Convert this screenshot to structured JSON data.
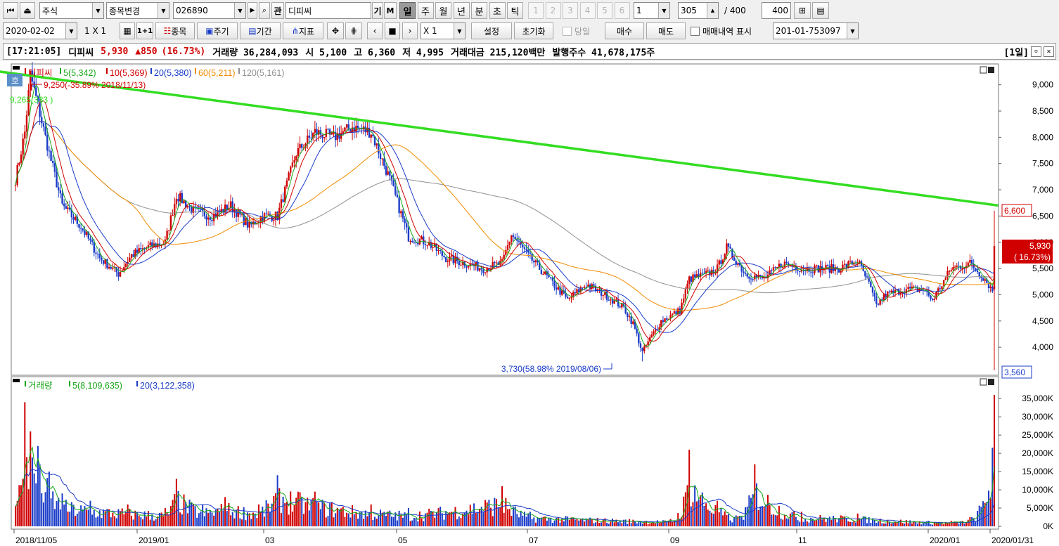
{
  "toolbar1": {
    "market": "주식",
    "code_change": "종목변경",
    "code": "026890",
    "search_icon_label": "Q",
    "related": "관",
    "name": "디피씨",
    "gi": "기",
    "m": "M",
    "periods": [
      "일",
      "주",
      "월",
      "년",
      "분",
      "초",
      "틱"
    ],
    "active_period": "일",
    "numbers": [
      "1",
      "2",
      "3",
      "4",
      "5",
      "6"
    ],
    "num_select": "1",
    "count": "305",
    "count_sep": "/ 400",
    "count_max": "400"
  },
  "toolbar2": {
    "date": "2020-02-02",
    "layout": "1 X 1",
    "one_one": "1+1",
    "stocks": "종목",
    "cycle": "주기",
    "term": "기간",
    "indicator": "지표",
    "multiplier": "X 1",
    "settings": "설정",
    "reset": "초기화",
    "today": "당일",
    "buy": "매수",
    "sell": "매도",
    "trade_history": "매매내역 표시",
    "account": "201-01-753097"
  },
  "infobar": {
    "time": "[17:21:05]",
    "name": "디피씨",
    "price": "5,930",
    "change": "▲850",
    "pct": "(16.73%)",
    "volume": "거래량 36,284,093",
    "open": "시 5,100",
    "high": "고 6,360",
    "low": "저 4,995",
    "amount": "거래대금 215,120백만",
    "shares": "발행주수 41,678,175주",
    "period_tag": "[1일]"
  },
  "price_panel": {
    "legend": [
      {
        "text": "디피씨",
        "color": "#d00000"
      },
      {
        "text": "5(5,342)",
        "color": "#1aa81a"
      },
      {
        "text": "10(5,369)",
        "color": "#d00000"
      },
      {
        "text": "20(5,380)",
        "color": "#1a3cc8"
      },
      {
        "text": "60(5,211)",
        "color": "#f08c00"
      },
      {
        "text": "120(5,161)",
        "color": "#909090"
      }
    ],
    "ho_badge": "호",
    "high_note": "9,250(-35.89% 2018/11/13)",
    "trend_note": "9,265(333 )",
    "low_note": "3,730(58.98% 2019/08/06)",
    "tag_high": "6,600",
    "tag_cur": "5,930",
    "tag_cur_pct": "( 16.73%)",
    "tag_low": "3,560",
    "yticks": [
      "9,000",
      "8,500",
      "8,000",
      "7,500",
      "7,000",
      "6,500",
      "6,000",
      "5,500",
      "5,000",
      "4,500",
      "4,000"
    ]
  },
  "volume_panel": {
    "legend": [
      {
        "text": "거래량",
        "color": "#1aa81a"
      },
      {
        "text": "5(8,109,635)",
        "color": "#1aa81a"
      },
      {
        "text": "20(3,122,358)",
        "color": "#1a3cc8"
      }
    ],
    "yticks": [
      "35,000K",
      "30,000K",
      "25,000K",
      "20,000K",
      "15,000K",
      "10,000K",
      "5,000K",
      "0K"
    ]
  },
  "xaxis": [
    "2018/11/05",
    "2019/01",
    "03",
    "05",
    "07",
    "09",
    "11",
    "2020/01",
    "2020/01/31"
  ],
  "colors": {
    "up": "#d00000",
    "down": "#1a3cc8",
    "trend": "#33dd22",
    "ma5": "#1aa81a",
    "ma10": "#d00000",
    "ma20": "#1a3cc8",
    "ma60": "#f08c00",
    "ma120": "#909090"
  },
  "chart_data": {
    "type": "candlestick",
    "price_range": [
      3560,
      9250
    ],
    "anchors_close": [
      [
        0,
        7200
      ],
      [
        5,
        8100
      ],
      [
        8,
        9200
      ],
      [
        12,
        8600
      ],
      [
        18,
        7700
      ],
      [
        25,
        6700
      ],
      [
        35,
        6300
      ],
      [
        45,
        5700
      ],
      [
        55,
        5400
      ],
      [
        62,
        5750
      ],
      [
        70,
        5900
      ],
      [
        80,
        6000
      ],
      [
        86,
        6900
      ],
      [
        95,
        6600
      ],
      [
        105,
        6500
      ],
      [
        115,
        6700
      ],
      [
        125,
        6300
      ],
      [
        132,
        6500
      ],
      [
        140,
        6500
      ],
      [
        150,
        7700
      ],
      [
        160,
        8100
      ],
      [
        170,
        8000
      ],
      [
        180,
        8200
      ],
      [
        190,
        8100
      ],
      [
        200,
        7200
      ],
      [
        210,
        6100
      ],
      [
        220,
        6000
      ],
      [
        230,
        5700
      ],
      [
        240,
        5600
      ],
      [
        250,
        5500
      ],
      [
        260,
        5600
      ],
      [
        265,
        6150
      ],
      [
        275,
        5700
      ],
      [
        285,
        5300
      ],
      [
        295,
        4900
      ],
      [
        305,
        5200
      ],
      [
        315,
        5000
      ],
      [
        325,
        4750
      ],
      [
        330,
        4450
      ],
      [
        335,
        3900
      ],
      [
        338,
        4100
      ],
      [
        345,
        4500
      ],
      [
        355,
        4700
      ],
      [
        360,
        5300
      ],
      [
        370,
        5400
      ],
      [
        375,
        5500
      ],
      [
        380,
        5900
      ],
      [
        390,
        5400
      ],
      [
        400,
        5300
      ],
      [
        410,
        5600
      ],
      [
        420,
        5500
      ],
      [
        430,
        5500
      ],
      [
        440,
        5500
      ],
      [
        450,
        5650
      ],
      [
        456,
        5200
      ],
      [
        460,
        4800
      ],
      [
        465,
        5000
      ],
      [
        475,
        5100
      ],
      [
        485,
        5100
      ],
      [
        490,
        4900
      ],
      [
        500,
        5500
      ],
      [
        510,
        5600
      ],
      [
        518,
        5300
      ],
      [
        522,
        5080
      ],
      [
        523,
        5930
      ]
    ],
    "volume_spikes_k": [
      [
        5,
        34000
      ],
      [
        8,
        26000
      ],
      [
        12,
        22000
      ],
      [
        18,
        15000
      ],
      [
        25,
        9000
      ],
      [
        40,
        7000
      ],
      [
        60,
        6000
      ],
      [
        80,
        5000
      ],
      [
        86,
        13000
      ],
      [
        100,
        6000
      ],
      [
        112,
        8000
      ],
      [
        130,
        6000
      ],
      [
        140,
        14000
      ],
      [
        160,
        9500
      ],
      [
        190,
        6000
      ],
      [
        210,
        5000
      ],
      [
        260,
        11000
      ],
      [
        275,
        4000
      ],
      [
        350,
        2000
      ],
      [
        360,
        21000
      ],
      [
        375,
        7000
      ],
      [
        385,
        3000
      ],
      [
        395,
        17000
      ],
      [
        420,
        4000
      ],
      [
        450,
        3500
      ],
      [
        500,
        1500
      ],
      [
        510,
        2500
      ],
      [
        523,
        36000
      ]
    ],
    "trendline": [
      [
        0,
        9265
      ],
      [
        523,
        6700
      ]
    ],
    "annotations": [
      "9,250(-35.89% 2018/11/13)",
      "3,730(58.98% 2019/08/06)"
    ]
  }
}
